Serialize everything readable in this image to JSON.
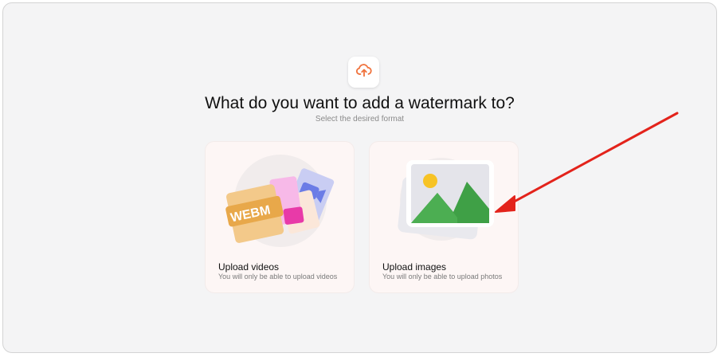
{
  "header": {
    "icon": "cloud-upload-icon",
    "title": "What do you want to add a watermark to?",
    "subtitle": "Select the desired format"
  },
  "cards": [
    {
      "title": "Upload videos",
      "description": "You will only be able to upload videos",
      "art_label": "WEBM",
      "art_label_2": "VI"
    },
    {
      "title": "Upload images",
      "description": "You will only be able to upload photos"
    }
  ],
  "colors": {
    "accent": "#f0743f",
    "annotation_arrow": "#e3231b",
    "card_bg": "#fdf6f5",
    "page_bg": "#f4f4f5"
  }
}
